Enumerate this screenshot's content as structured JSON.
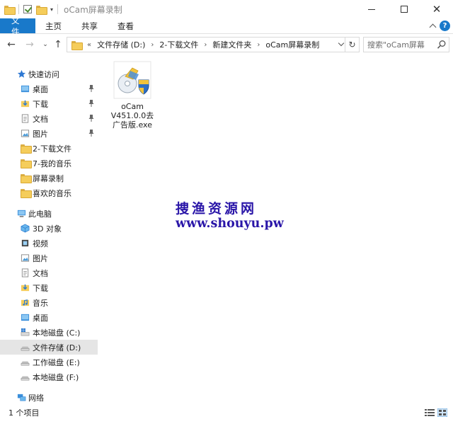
{
  "window": {
    "title": "oCam屏幕录制"
  },
  "ribbon": {
    "tabs": [
      "文件",
      "主页",
      "共享",
      "查看"
    ],
    "help": "?"
  },
  "address": {
    "crumbs": [
      "文件存储 (D:)",
      "2-下载文件",
      "新建文件夹",
      "oCam屏幕录制"
    ],
    "search_placeholder": "搜索\"oCam屏幕"
  },
  "nav": {
    "quick_access": "快速访问",
    "quick_items": [
      {
        "label": "桌面",
        "pinned": true
      },
      {
        "label": "下载",
        "pinned": true
      },
      {
        "label": "文档",
        "pinned": true
      },
      {
        "label": "图片",
        "pinned": true
      },
      {
        "label": "2-下载文件",
        "pinned": false
      },
      {
        "label": "7-我的音乐",
        "pinned": false
      },
      {
        "label": "屏幕录制",
        "pinned": false
      },
      {
        "label": "喜欢的音乐",
        "pinned": false
      }
    ],
    "this_pc": "此电脑",
    "pc_items": [
      "3D 对象",
      "视频",
      "图片",
      "文档",
      "下载",
      "音乐",
      "桌面",
      "本地磁盘 (C:)",
      "文件存储 (D:)",
      "工作磁盘 (E:)",
      "本地磁盘 (F:)"
    ],
    "network": "网络"
  },
  "files": [
    {
      "name_line1": "oCam",
      "name_line2": "V451.0.0去",
      "name_line3": "广告版.exe"
    }
  ],
  "watermark": {
    "line1": "捜渔资源网",
    "line2": "www.shouyu.pw"
  },
  "status": {
    "item_count": "1 个项目"
  }
}
